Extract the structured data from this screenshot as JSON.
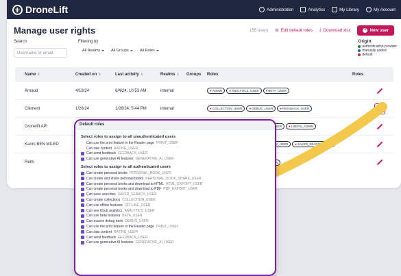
{
  "brand": "DroneLift",
  "topnav": [
    {
      "label": "Administration",
      "icon": "gear-icon"
    },
    {
      "label": "Analytics",
      "icon": "analytics-icon"
    },
    {
      "label": "My Library",
      "icon": "library-icon"
    },
    {
      "label": "My Account",
      "icon": "account-icon"
    }
  ],
  "page_title": "Manage user rights",
  "user_count": "155 users",
  "edit_default_roles": "Edit default roles",
  "download_xlsx": "Download xlsx",
  "new_user": "New user",
  "search_label": "Search",
  "search_placeholder": "Username or email",
  "filtering_label": "Filtering by",
  "filters": [
    "All Realms",
    "All Groups",
    "All Roles"
  ],
  "origin": {
    "title": "Origin",
    "items": [
      {
        "label": "authentication provider",
        "color": "#2e7d32"
      },
      {
        "label": "manually added",
        "color": "#1565c0"
      },
      {
        "label": "default",
        "color": "#c62828"
      }
    ]
  },
  "columns": [
    "Name",
    "Created on",
    "Last activity",
    "Realms",
    "Groups",
    "Roles",
    "Roles"
  ],
  "users": [
    {
      "name": "Arnaud",
      "created": "4/18/24",
      "last": "6/4/24, 10:53 AM",
      "realm": "internal",
      "roles": [
        "ADMIN",
        "ANALYTICS_USER",
        "BETA_USER"
      ]
    },
    {
      "name": "Clément",
      "created": "1/26/24",
      "last": "1/26/24, 5:44 PM",
      "realm": "internal",
      "roles": [
        "COLLECTION_USER",
        "DEBUG_USER",
        "FEEDBACK_USER"
      ]
    },
    {
      "name": "Dronelift API",
      "created": "1",
      "last": "",
      "realm": "",
      "roles": [
        "_USER",
        "USERS_ADMIN"
      ]
    },
    {
      "name": "Karim BEN MILED",
      "created": "1",
      "last": "",
      "realm": "",
      "roles": [
        "ACK_USER",
        "SAVED_SEARCH_USER"
      ]
    },
    {
      "name": "Rémi",
      "created": "1",
      "last": "",
      "realm": "",
      "roles": [
        "SER"
      ]
    }
  ],
  "popup": {
    "title": "Default roles",
    "unauth_title": "Select roles to assign to all unauthenticated users",
    "unauth_roles": [
      {
        "label": "Can use the print feature in the Reader page",
        "code": "PRINT_USER",
        "checked": false
      },
      {
        "label": "Can rate content",
        "code": "RATING_USER",
        "checked": false
      },
      {
        "label": "Can send feedback",
        "code": "FEEDBACK_USER",
        "checked": true
      },
      {
        "label": "Can use generative AI features",
        "code": "GENERATIVE_AI_USER",
        "checked": true
      }
    ],
    "auth_title": "Select roles to assign to all authenticated users",
    "auth_roles": [
      {
        "label": "Can create personal books",
        "code": "PERSONAL_BOOK_USER"
      },
      {
        "label": "Can create and share personal books",
        "code": "PERSONAL_BOOK_SHARE_USER"
      },
      {
        "label": "Can create personal books and download to HTML",
        "code": "HTML_EXPORT_USER"
      },
      {
        "label": "Can create personal books and download to PDF",
        "code": "PDF_EXPORT_USER"
      },
      {
        "label": "Can save searches",
        "code": "SAVED_SEARCH_USER"
      },
      {
        "label": "Can create collections",
        "code": "COLLECTION_USER"
      },
      {
        "label": "Can use offline features",
        "code": "OFFLINE_USER"
      },
      {
        "label": "Can see Khub analytics",
        "code": "ANALYTICS_USER"
      },
      {
        "label": "Can use beta features",
        "code": "BETA_USER"
      },
      {
        "label": "Can access debug tools",
        "code": "DEBUG_USER"
      },
      {
        "label": "Can use the print feature in the Reader page",
        "code": "PRINT_USER"
      },
      {
        "label": "Can rate content",
        "code": "RATING_USER"
      },
      {
        "label": "Can send feedback",
        "code": "FEEDBACK_USER"
      },
      {
        "label": "Can use generative AI features",
        "code": "GENERATIVE_AI_USER"
      }
    ]
  },
  "colors": {
    "accent": "#c2185b",
    "nav": "#1f2840",
    "popup_border": "#7b1fa2",
    "arrow": "#f2c94c"
  }
}
